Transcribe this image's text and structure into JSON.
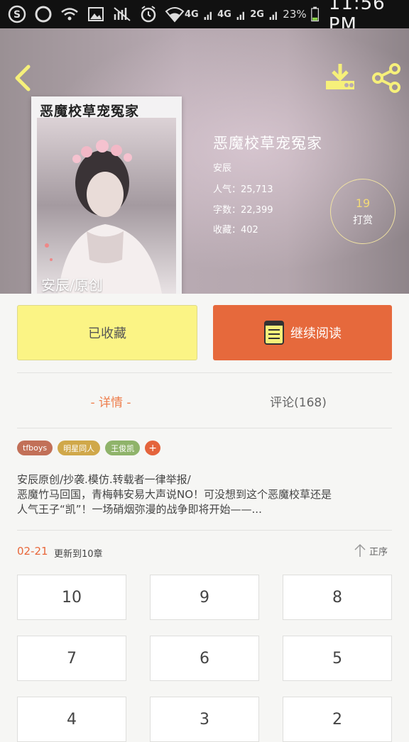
{
  "status_bar": {
    "network_labels": [
      "4G",
      "4G",
      "2G"
    ],
    "battery": "23%",
    "time": "11:56 PM",
    "icons": [
      "s-icon",
      "circle-icon",
      "wifi-calling-icon",
      "image-icon",
      "mute-icon",
      "alarm-icon",
      "wifi-icon",
      "signal-icon",
      "battery-icon"
    ]
  },
  "book": {
    "cover_title": "恶魔校草宠冤家",
    "cover_caption": "安辰/原创",
    "title": "恶魔校草宠冤家",
    "author": "安辰",
    "popularity": "人气：25,713",
    "word_count": "字数：22,399",
    "favorites": "收藏：402"
  },
  "tip": {
    "count": "19",
    "label": "打赏"
  },
  "actions": {
    "collected_label": "已收藏",
    "read_label": "继续阅读"
  },
  "tabs": {
    "details": "- 详情 -",
    "comments": "评论(168)"
  },
  "tags": [
    {
      "label": "tfboys",
      "color": "#c27058"
    },
    {
      "label": "明星同人",
      "color": "#d0a84a"
    },
    {
      "label": "王俊凯",
      "color": "#8fb36a"
    }
  ],
  "tag_add": "+",
  "description": {
    "line1": "安辰原创/抄袭.模仿.转载者一律举报/",
    "line2": "恶魔竹马回国，青梅韩安易大声说NO！可没想到这个恶魔校草还是",
    "line3": "人气王子“凯”！一场硝烟弥漫的战争即将开始——..."
  },
  "update": {
    "date": "02-21",
    "text": "更新到10章",
    "sort_label": "正序"
  },
  "chapters": [
    "10",
    "9",
    "8",
    "7",
    "6",
    "5",
    "4",
    "3",
    "2"
  ],
  "colors": {
    "accent_orange": "#e6693c",
    "collected_yellow": "#fbf485",
    "tip_gold": "#f2da78"
  }
}
